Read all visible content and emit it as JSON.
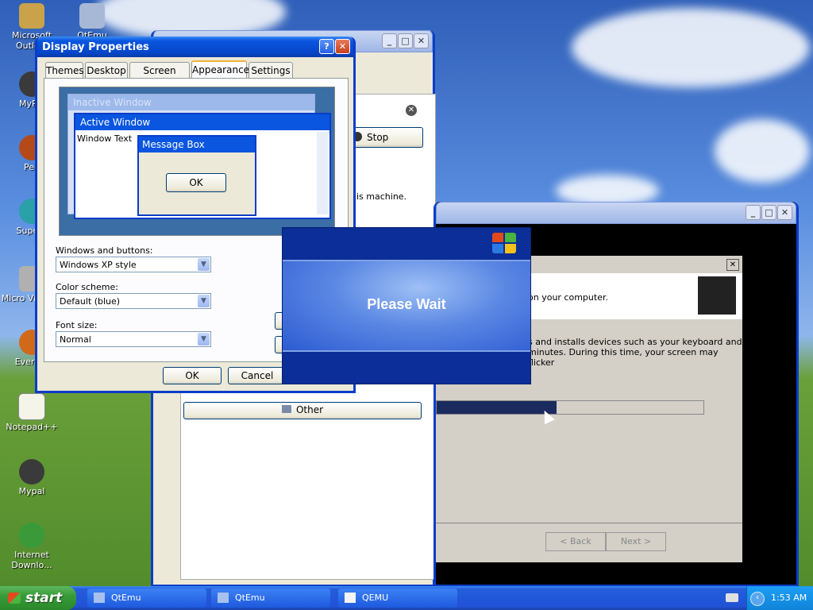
{
  "desktop": {
    "icons": [
      {
        "label": "Microsoft Outlo..."
      },
      {
        "label": "QtEmu"
      },
      {
        "label": "MyPal"
      },
      {
        "label": "Peg"
      },
      {
        "label": "Supern"
      },
      {
        "label": "Micro Visual S"
      },
      {
        "label": "Everyth"
      },
      {
        "label": "Notepad++"
      },
      {
        "label": "Mypal"
      },
      {
        "label": "Internet Downlo..."
      }
    ]
  },
  "display_properties": {
    "title": "Display Properties",
    "tabs": [
      "Themes",
      "Desktop",
      "Screen Saver",
      "Appearance",
      "Settings"
    ],
    "active_tab": "Appearance",
    "preview": {
      "inactive_window": "Inactive Window",
      "active_window": "Active Window",
      "window_text": "Window Text",
      "message_box": "Message Box",
      "ok": "OK"
    },
    "windows_and_buttons_label": "Windows and buttons:",
    "windows_and_buttons_value": "Windows XP style",
    "color_scheme_label": "Color scheme:",
    "color_scheme_value": "Default (blue)",
    "font_size_label": "Font size:",
    "font_size_value": "Normal",
    "ok": "OK",
    "cancel": "Cancel"
  },
  "back_window": {
    "stop_label": "Stop",
    "text_fragment": "is machine.",
    "other_label": "Other"
  },
  "qemu_setup": {
    "text1": "on your computer.",
    "text2": "s and installs devices such as your keyboard and",
    "text3": "minutes.  During this time, your screen may flicker",
    "progress_fraction": 0.45,
    "back": "< Back",
    "next": "Next >"
  },
  "please_wait": {
    "message": "Please Wait"
  },
  "taskbar": {
    "start": "start",
    "buttons": [
      "QtEmu",
      "QtEmu",
      "QEMU"
    ],
    "clock": "1:53 AM"
  },
  "colors": {
    "xp_blue": "#0a56e0",
    "start_green": "#379b37",
    "progress_fill": "#1c2b5e"
  }
}
